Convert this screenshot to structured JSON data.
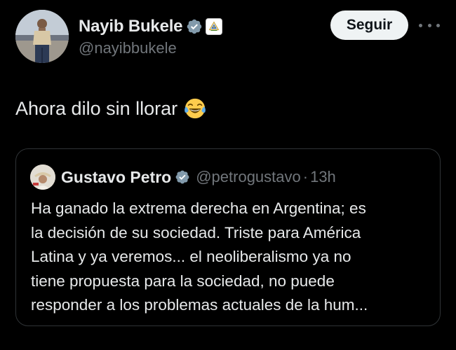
{
  "tweet": {
    "display_name": "Nayib Bukele",
    "handle": "@nayibbukele",
    "follow_label": "Seguir",
    "text": "Ahora dilo sin llorar",
    "emoji": "😂"
  },
  "quoted_tweet": {
    "display_name": "Gustavo Petro",
    "handle": "@petrogustavo",
    "separator": "·",
    "time": "13h",
    "lines": [
      "Ha ganado la extrema derecha en Argentina; es",
      "la decisión de su sociedad. Triste para América",
      "Latina y ya veremos... el neoliberalismo ya no",
      "tiene propuesta para la sociedad, no puede",
      "responder a los problemas actuales de la hum..."
    ]
  },
  "icons": {
    "verified": "verified-badge-icon",
    "government_badge": "el-salvador-coat-of-arms-icon",
    "more": "more-options-icon"
  },
  "colors": {
    "background": "#000000",
    "primary_text": "#e7e9ea",
    "secondary_text": "#71767b",
    "verified_badge": "#829aab",
    "follow_button_bg": "#eff3f4",
    "quote_border": "#2f3336"
  }
}
